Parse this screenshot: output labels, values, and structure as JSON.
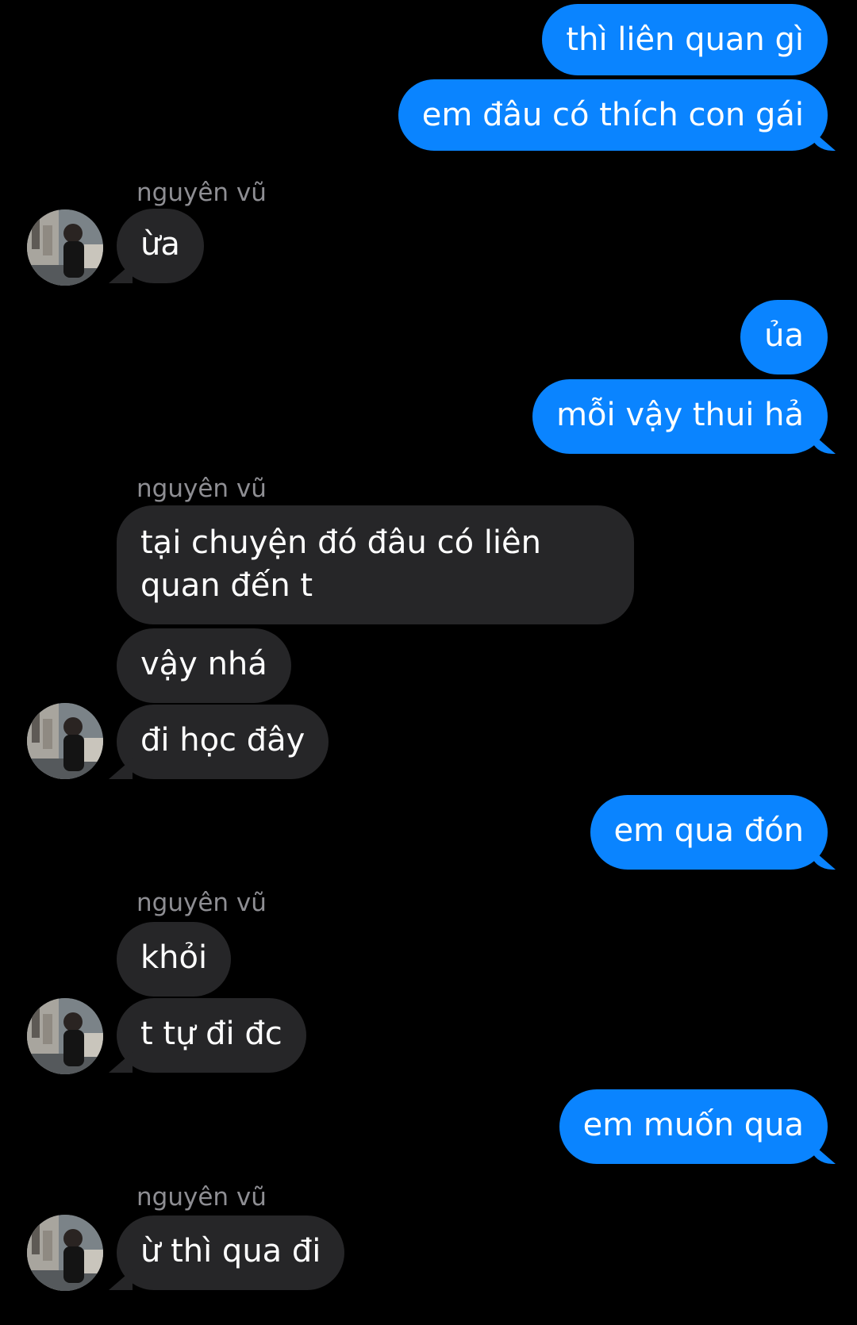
{
  "conversation": {
    "contact_name": "nguyên vũ",
    "messages": [
      {
        "from": "me",
        "text": "thì liên quan gì"
      },
      {
        "from": "me",
        "text": "em đâu có thích con gái"
      },
      {
        "from": "them",
        "text": "ừa"
      },
      {
        "from": "me",
        "text": "ủa"
      },
      {
        "from": "me",
        "text": "mỗi vậy thui hả"
      },
      {
        "from": "them",
        "text": "tại chuyện đó đâu có liên quan đến t"
      },
      {
        "from": "them",
        "text": "vậy nhá"
      },
      {
        "from": "them",
        "text": "đi học đây"
      },
      {
        "from": "me",
        "text": "em qua đón"
      },
      {
        "from": "them",
        "text": "khỏi"
      },
      {
        "from": "them",
        "text": "t tự đi đc"
      },
      {
        "from": "me",
        "text": "em muốn qua"
      },
      {
        "from": "them",
        "text": "ừ thì qua đi"
      }
    ]
  },
  "colors": {
    "background": "#000000",
    "outgoing_bubble": "#0a84ff",
    "incoming_bubble": "#262628",
    "sender_name": "#8e8e93"
  },
  "avatar_icon": "profile-photo-icon"
}
